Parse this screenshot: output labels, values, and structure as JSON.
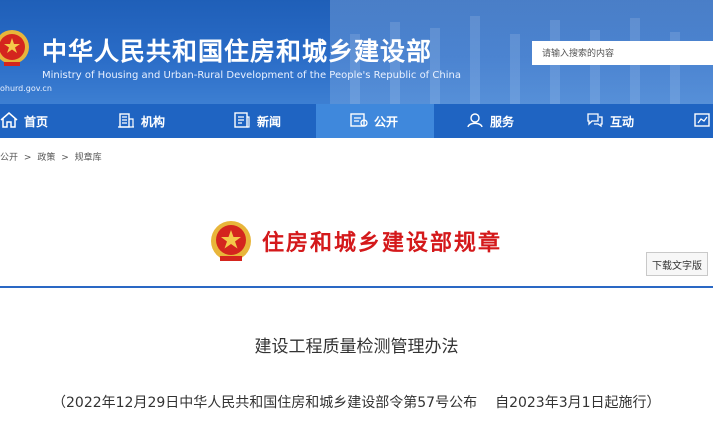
{
  "header": {
    "title": "中华人民共和国住房和城乡建设部",
    "subtitle": "Ministry of Housing and Urban-Rural Development of the People's Republic of China",
    "domain": "ohurd.gov.cn",
    "search_placeholder": "请输入搜索的内容"
  },
  "nav": {
    "items": [
      {
        "label": "首页",
        "icon": "home-icon"
      },
      {
        "label": "机构",
        "icon": "building-icon"
      },
      {
        "label": "新闻",
        "icon": "news-icon"
      },
      {
        "label": "公开",
        "icon": "public-icon",
        "active": true
      },
      {
        "label": "服务",
        "icon": "service-icon"
      },
      {
        "label": "互动",
        "icon": "interact-icon"
      },
      {
        "label": "",
        "icon": "data-icon"
      }
    ]
  },
  "breadcrumb": [
    "公开",
    ">",
    "政策",
    ">",
    "规章库"
  ],
  "banner": {
    "title": "住房和城乡建设部规章",
    "download_label": "下载文字版"
  },
  "document": {
    "title": "建设工程质量检测管理办法",
    "publish_info": "（2022年12月29日中华人民共和国住房和城乡建设部令第57号公布",
    "effective_info": "自2023年3月1日起施行）"
  },
  "colors": {
    "header_blue": "#2a6cc7",
    "nav_blue": "#1f64c2",
    "nav_active": "#3f88dc",
    "title_red": "#d4191b"
  }
}
